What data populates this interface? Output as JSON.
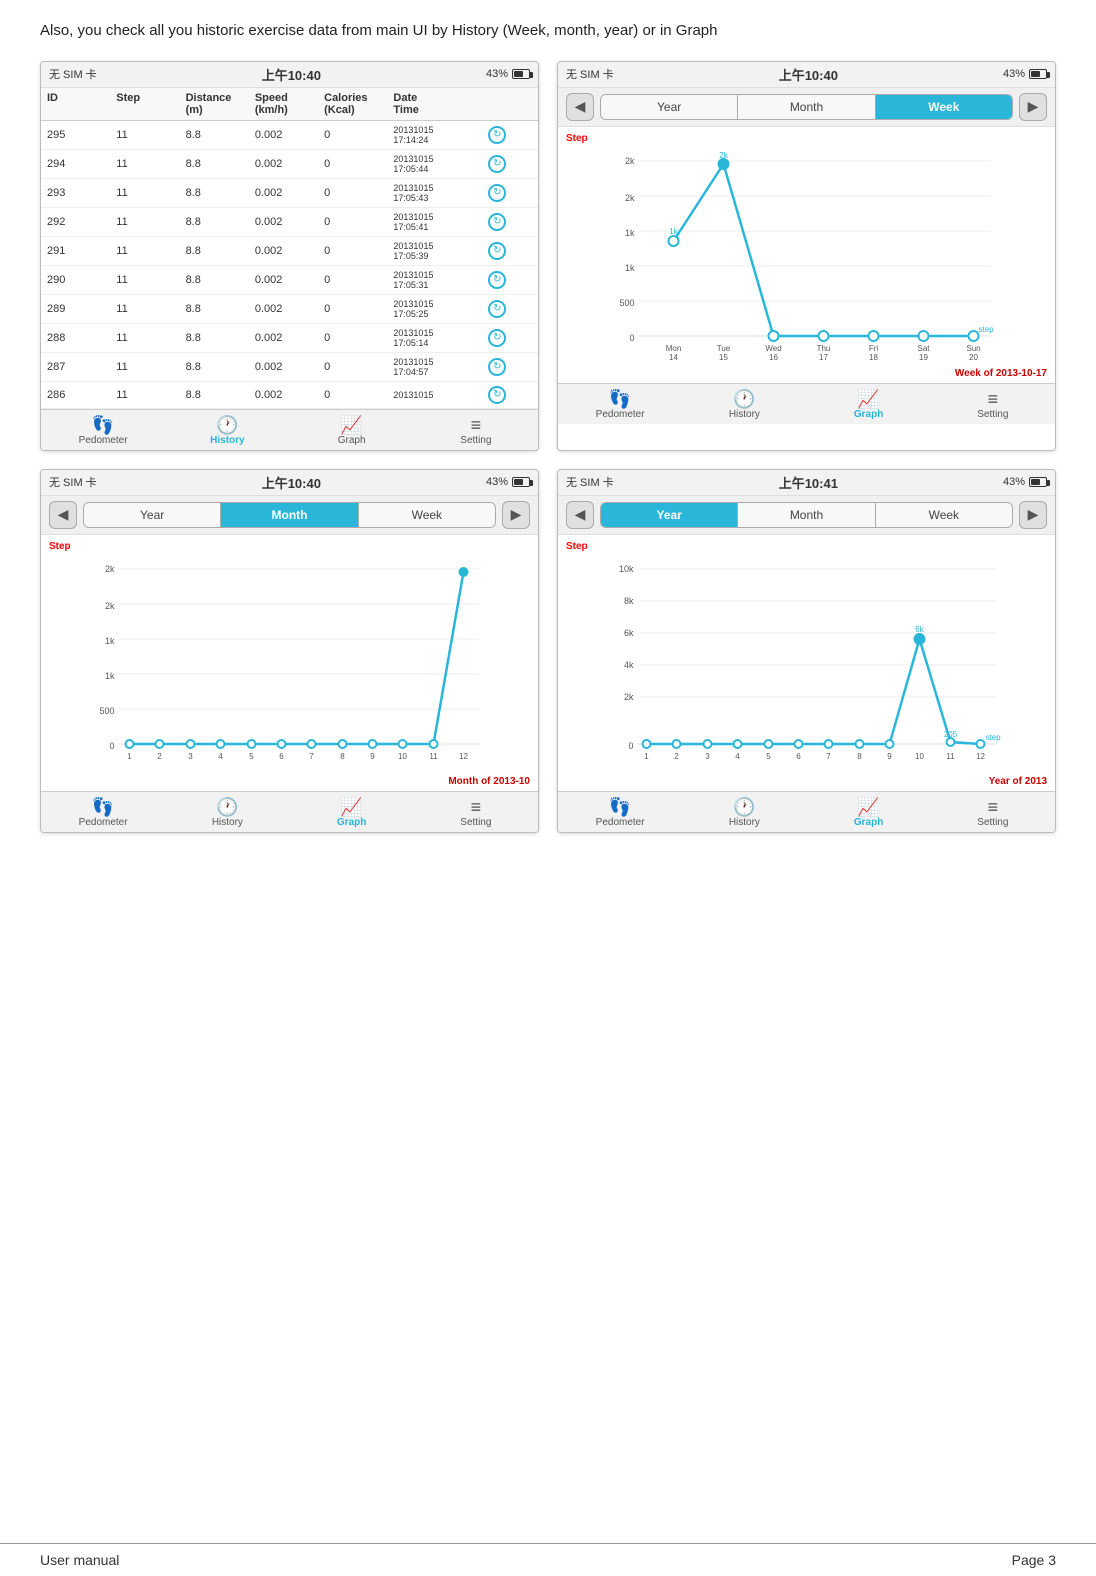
{
  "page": {
    "intro": "Also, you check all you historic exercise data from main UI by History (Week, month, year) or in Graph",
    "footer_left": "User manual",
    "footer_right": "Page 3"
  },
  "screens": {
    "top_left": {
      "title": "History Table",
      "status_left": "无 SIM 卡",
      "status_time": "上午10:40",
      "status_right": "43%",
      "columns": [
        "ID",
        "Step",
        "Distance\n(m)",
        "Speed\n(km/h)",
        "Calories\n(Kcal)",
        "Date\nTime"
      ],
      "rows": [
        {
          "id": "295",
          "step": "11",
          "dist": "8.8",
          "speed": "0.002",
          "cal": "0",
          "date": "20131015\n17:14:24"
        },
        {
          "id": "294",
          "step": "11",
          "dist": "8.8",
          "speed": "0.002",
          "cal": "0",
          "date": "20131015\n17:05:44"
        },
        {
          "id": "293",
          "step": "11",
          "dist": "8.8",
          "speed": "0.002",
          "cal": "0",
          "date": "20131015\n17:05:43"
        },
        {
          "id": "292",
          "step": "11",
          "dist": "8.8",
          "speed": "0.002",
          "cal": "0",
          "date": "20131015\n17:05:41"
        },
        {
          "id": "291",
          "step": "11",
          "dist": "8.8",
          "speed": "0.002",
          "cal": "0",
          "date": "20131015\n17:05:39"
        },
        {
          "id": "290",
          "step": "11",
          "dist": "8.8",
          "speed": "0.002",
          "cal": "0",
          "date": "20131015\n17:05:31"
        },
        {
          "id": "289",
          "step": "11",
          "dist": "8.8",
          "speed": "0.002",
          "cal": "0",
          "date": "20131015\n17:05:25"
        },
        {
          "id": "288",
          "step": "11",
          "dist": "8.8",
          "speed": "0.002",
          "cal": "0",
          "date": "20131015\n17:05:14"
        },
        {
          "id": "287",
          "step": "11",
          "dist": "8.8",
          "speed": "0.002",
          "cal": "0",
          "date": "20131015\n17:04:57"
        },
        {
          "id": "286",
          "step": "11",
          "dist": "8.8",
          "speed": "0.002",
          "cal": "0",
          "date": "20131015"
        }
      ],
      "bottom_nav": [
        {
          "label": "Pedometer",
          "icon": "👣",
          "active": false
        },
        {
          "label": "History",
          "icon": "🕐",
          "active": true
        },
        {
          "label": "Graph",
          "icon": "📈",
          "active": false
        },
        {
          "label": "Setting",
          "icon": "≡",
          "active": false
        }
      ]
    },
    "top_right": {
      "title": "Graph Week",
      "status_left": "无 SIM 卡",
      "status_time": "上午10:40",
      "status_right": "43%",
      "active_tab": "Week",
      "tabs": [
        "Year",
        "Month",
        "Week"
      ],
      "graph_label": "Step",
      "week_label": "Week of 2013-10-17",
      "x_labels": [
        "Mon\n14",
        "Tue\n15",
        "Wed\n16",
        "Thu\n17",
        "Fri\n18",
        "Sat\n19",
        "Sun\n20"
      ],
      "y_labels": [
        "2k",
        "2k",
        "1k",
        "1k",
        "500",
        "0"
      ],
      "bottom_nav": [
        {
          "label": "Pedometer",
          "icon": "👣",
          "active": false
        },
        {
          "label": "History",
          "icon": "🕐",
          "active": false
        },
        {
          "label": "Graph",
          "icon": "📈",
          "active": true
        },
        {
          "label": "Setting",
          "icon": "≡",
          "active": false
        }
      ]
    },
    "bottom_left": {
      "title": "Graph Month",
      "status_left": "无 SIM 卡",
      "status_time": "上午10:40",
      "status_right": "43%",
      "active_tab": "Month",
      "tabs": [
        "Year",
        "Month",
        "Week"
      ],
      "graph_label": "Step",
      "month_label": "Month of 2013-10",
      "x_labels": [
        "1",
        "2",
        "3",
        "4",
        "5",
        "6",
        "7",
        "8",
        "9",
        "10",
        "11",
        "12"
      ],
      "y_labels": [
        "2k",
        "2k",
        "1k",
        "1k",
        "500",
        "0"
      ],
      "bottom_nav": [
        {
          "label": "Pedometer",
          "icon": "👣",
          "active": false
        },
        {
          "label": "History",
          "icon": "🕐",
          "active": false
        },
        {
          "label": "Graph",
          "icon": "📈",
          "active": true
        },
        {
          "label": "Setting",
          "icon": "≡",
          "active": false
        }
      ]
    },
    "bottom_right": {
      "title": "Graph Year",
      "status_left": "无 SIM 卡",
      "status_time": "上午10:41",
      "status_right": "43%",
      "active_tab": "Year",
      "tabs": [
        "Year",
        "Month",
        "Week"
      ],
      "graph_label": "Step",
      "year_label": "Year of 2013",
      "x_labels": [
        "1",
        "2",
        "3",
        "4",
        "5",
        "6",
        "7",
        "8",
        "9",
        "10",
        "11",
        "12"
      ],
      "y_labels": [
        "10k",
        "8k",
        "6k",
        "4k",
        "2k",
        "0"
      ],
      "bottom_nav": [
        {
          "label": "Pedometer",
          "icon": "👣",
          "active": false
        },
        {
          "label": "History",
          "icon": "🕐",
          "active": false
        },
        {
          "label": "Graph",
          "icon": "📈",
          "active": true
        },
        {
          "label": "Setting",
          "icon": "≡",
          "active": false
        }
      ]
    }
  }
}
